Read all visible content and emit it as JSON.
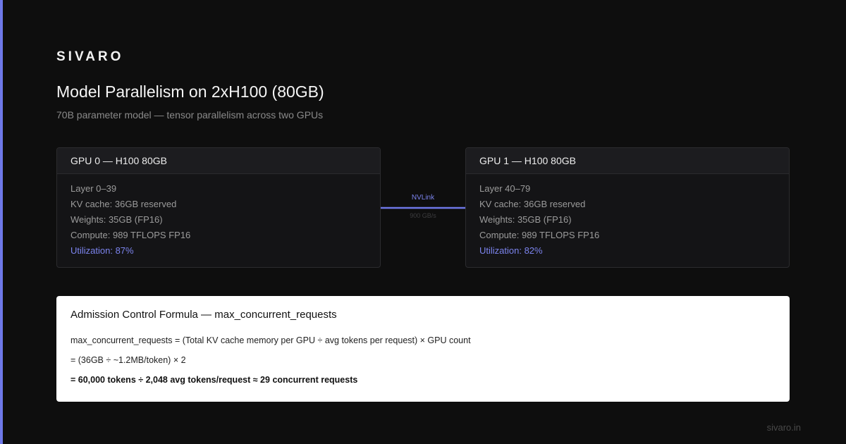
{
  "brand": "SIVARO",
  "title": "Model Parallelism on 2xH100 (80GB)",
  "subtitle": "70B parameter model — tensor parallelism across two GPUs",
  "gpus": [
    {
      "header": "GPU 0 — H100 80GB",
      "layers": "Layer 0–39",
      "kv_cache": "KV cache: 36GB reserved",
      "weights": "Weights: 35GB (FP16)",
      "compute": "Compute: 989 TFLOPS FP16",
      "utilization": "Utilization: 87%"
    },
    {
      "header": "GPU 1 — H100 80GB",
      "layers": "Layer 40–79",
      "kv_cache": "KV cache: 36GB reserved",
      "weights": "Weights: 35GB (FP16)",
      "compute": "Compute: 989 TFLOPS FP16",
      "utilization": "Utilization: 82%"
    }
  ],
  "link": {
    "label": "NVLink",
    "bandwidth": "900 GB/s",
    "icon": "arrow-right-icon"
  },
  "formula": {
    "title": "Admission Control Formula — max_concurrent_requests",
    "line1": "max_concurrent_requests = (Total KV cache memory per GPU ÷ avg tokens per request) × GPU count",
    "line2": "= (36GB ÷ ~1.2MB/token) × 2",
    "line3": "= 60,000 tokens ÷ 2,048 avg tokens/request ≈ 29 concurrent requests"
  },
  "footer": "sivaro.in",
  "colors": {
    "accent": "#6e78e8",
    "background": "#0e0e0e",
    "card": "#141416",
    "utilization": "#7c84ee"
  }
}
